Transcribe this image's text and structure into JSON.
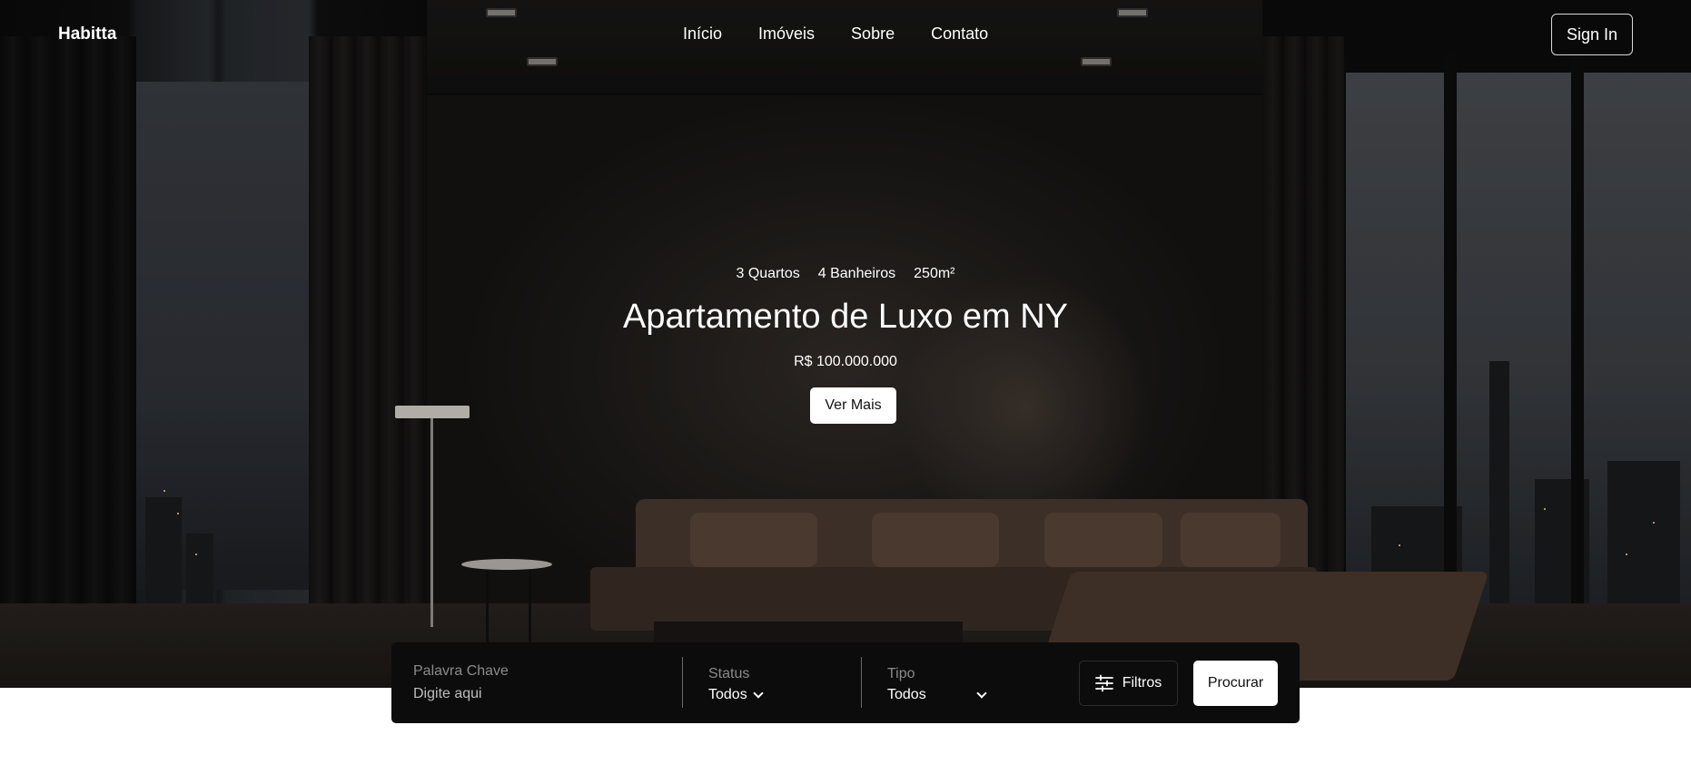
{
  "brand": {
    "name": "Habitta"
  },
  "nav": {
    "links": [
      {
        "label": "Início"
      },
      {
        "label": "Imóveis"
      },
      {
        "label": "Sobre"
      },
      {
        "label": "Contato"
      }
    ],
    "signin_label": "Sign In"
  },
  "hero": {
    "meta": {
      "rooms": "3 Quartos",
      "baths": "4 Banheiros",
      "area": "250m²"
    },
    "title": "Apartamento de Luxo em NY",
    "price": "R$ 100.000.000",
    "cta_label": "Ver Mais"
  },
  "search": {
    "keyword": {
      "label": "Palavra Chave",
      "placeholder": "Digite aqui",
      "value": ""
    },
    "status": {
      "label": "Status",
      "selected": "Todos"
    },
    "type": {
      "label": "Tipo",
      "selected": "Todos"
    },
    "filters_label": "Filtros",
    "submit_label": "Procurar"
  },
  "icons": {
    "filters": "sliders-icon",
    "dropdown": "chevron-down-icon"
  },
  "colors": {
    "search_bg": "#0c0c0c",
    "button_bg": "#ffffff",
    "button_text": "#111111"
  }
}
